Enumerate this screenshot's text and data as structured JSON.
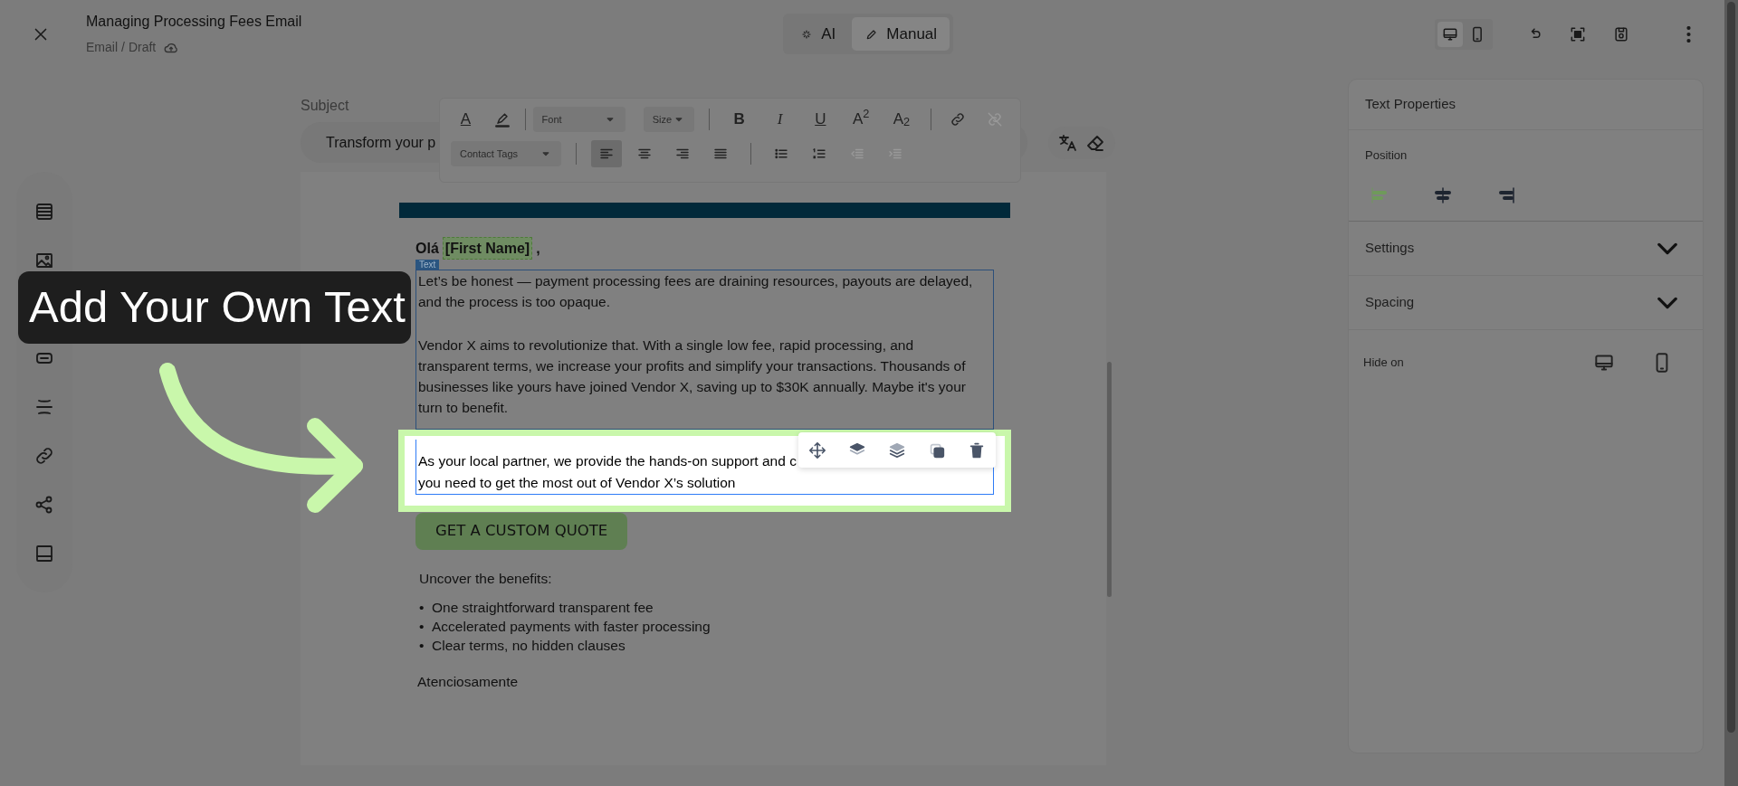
{
  "header": {
    "title": "Managing Processing Fees Email",
    "breadcrumb": [
      "Email",
      "Draft"
    ],
    "breadcrumb_separator": "/",
    "modes": [
      {
        "kind": "ai",
        "label": "AI",
        "selected": false
      },
      {
        "kind": "manual",
        "label": "Manual",
        "selected": true
      }
    ],
    "devices": [
      {
        "kind": "desktop",
        "selected": true
      },
      {
        "kind": "mobile",
        "selected": false
      }
    ]
  },
  "subject": {
    "label": "Subject",
    "value": "Transform your p"
  },
  "format_toolbar": {
    "font": "Font",
    "size": "Size",
    "contact_tags": "Contact Tags",
    "text_color": "A",
    "styles": [
      {
        "kind": "bold",
        "label": "B"
      },
      {
        "kind": "italic",
        "label": "I"
      },
      {
        "kind": "underline",
        "label": "U"
      },
      {
        "kind": "sup",
        "label": "A$^{2}$"
      },
      {
        "kind": "sub",
        "label": "A$_{2}$"
      }
    ],
    "link_disabled": false,
    "unlink_disabled": true,
    "alignments": [
      {
        "kind": "left",
        "selected": true
      },
      {
        "kind": "center",
        "selected": false
      },
      {
        "kind": "right",
        "selected": false
      },
      {
        "kind": "justify",
        "selected": false
      }
    ],
    "indent_disabled": true
  },
  "tutorial": {
    "callout": "Add Your Own Text"
  },
  "email": {
    "greeting": "Olá",
    "merge_tag": "[First Name]",
    "greeting_end": ",",
    "block_tag": "Text",
    "paragraphs": [
      "Let’s be honest — payment processing fees are draining resources, payouts are delayed, and the process is too opaque.",
      "Vendor X aims to revolutionize that. With a single low fee, rapid processing, and transparent terms, we increase your profits and simplify your transactions. Thousands of businesses like yours have joined Vendor X, saving up to $30K annually. Maybe it's your turn to benefit."
    ],
    "highlighted_lines": [
      "As your local partner, we provide the hands-on support and c",
      "you need to get the most out of Vendor X’s solution"
    ],
    "bullet": "•",
    "cta": "GET A CUSTOM QUOTE",
    "benefits_title": "Uncover the benefits:",
    "benefits": [
      "One straightforward transparent fee",
      "Accelerated payments with faster processing",
      "Clear terms, no hidden clauses"
    ],
    "closing": "Atenciosamente"
  },
  "properties": {
    "title": "Text Properties",
    "position_label": "Position",
    "positions": [
      {
        "kind": "left",
        "selected": true
      },
      {
        "kind": "center",
        "selected": false
      },
      {
        "kind": "right",
        "selected": false
      }
    ],
    "sections": [
      {
        "label": "Settings",
        "expanded": false
      },
      {
        "label": "Spacing",
        "expanded": false
      }
    ],
    "hide_on": "Hide on"
  }
}
